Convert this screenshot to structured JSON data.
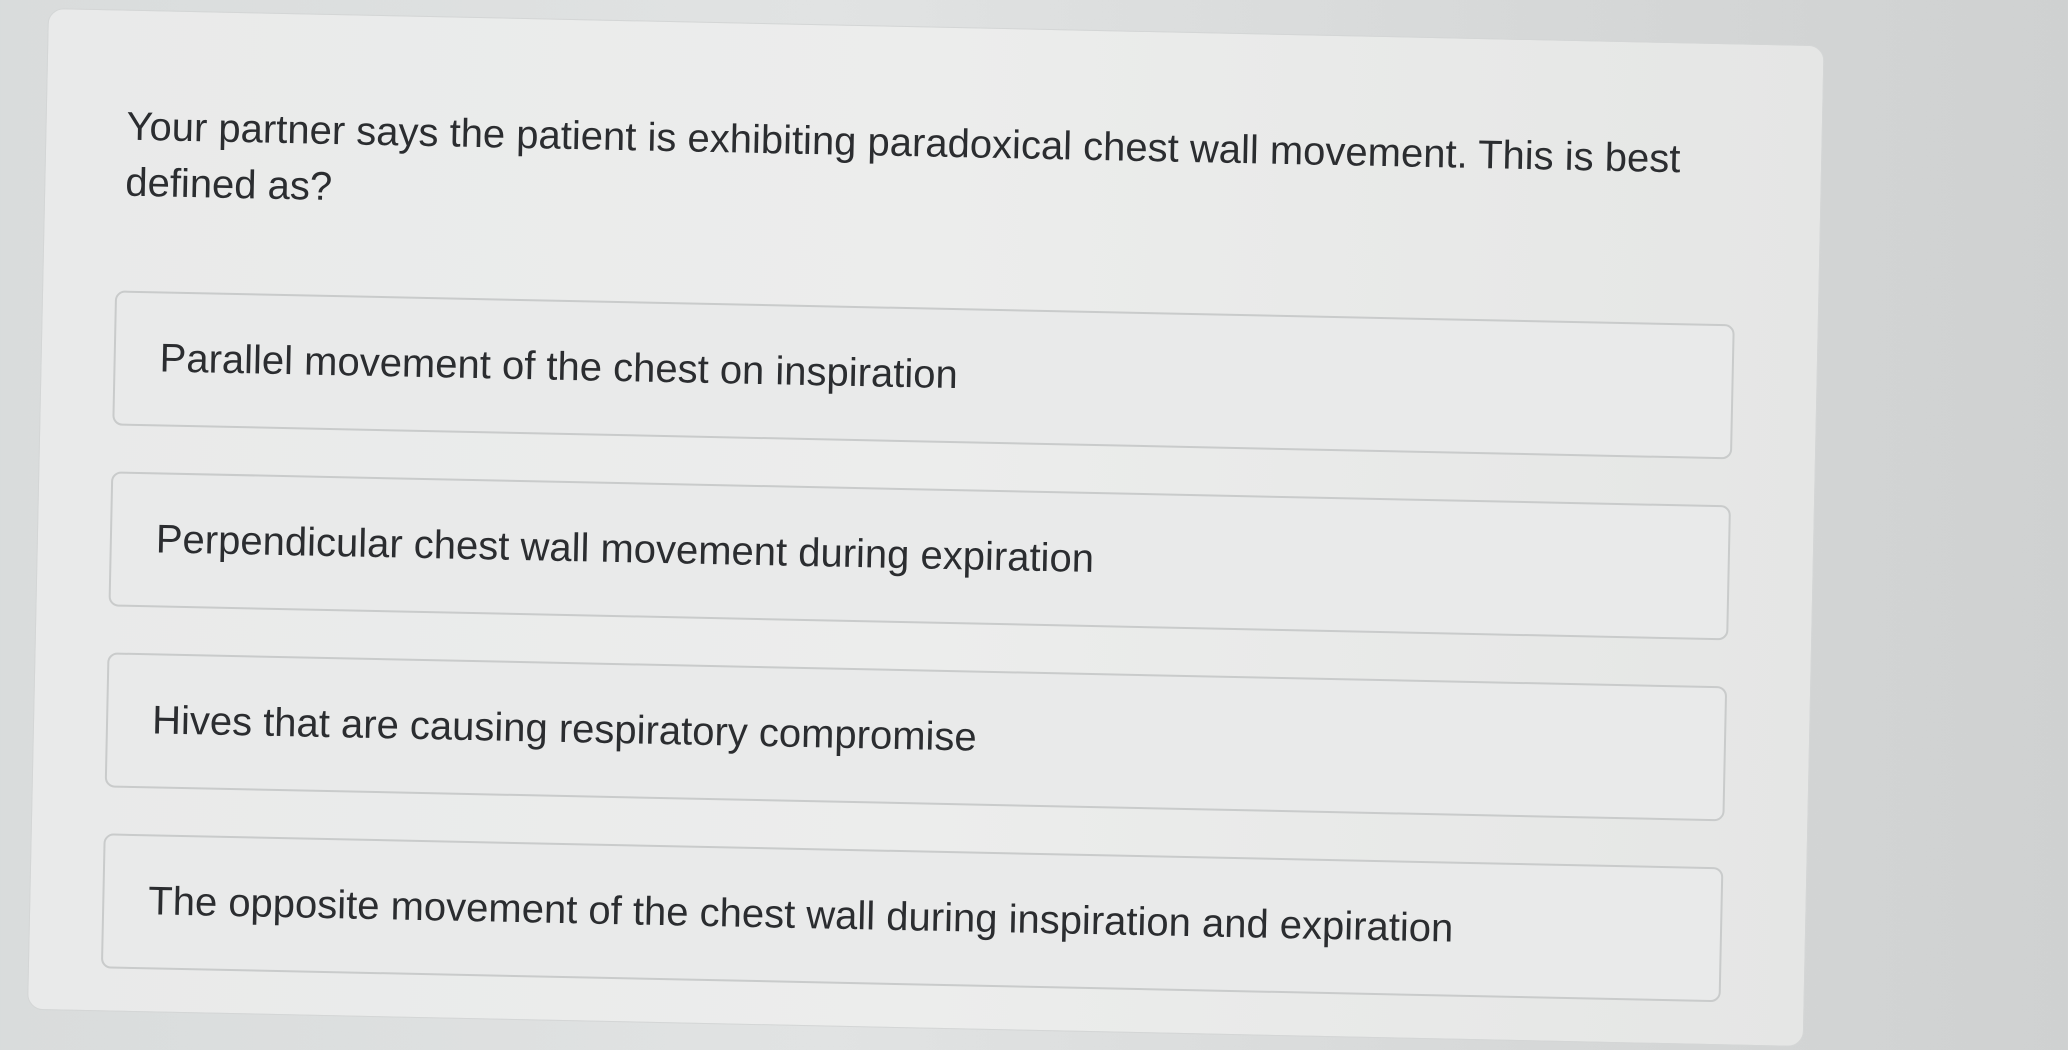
{
  "question": {
    "text": "Your partner says the patient is exhibiting paradoxical chest wall movement. This is best defined as?"
  },
  "options": [
    {
      "label": "Parallel movement of the chest on inspiration"
    },
    {
      "label": "Perpendicular chest wall movement during expiration"
    },
    {
      "label": "Hives that are causing respiratory compromise"
    },
    {
      "label": "The opposite movement of the chest wall during inspiration and expiration"
    }
  ]
}
